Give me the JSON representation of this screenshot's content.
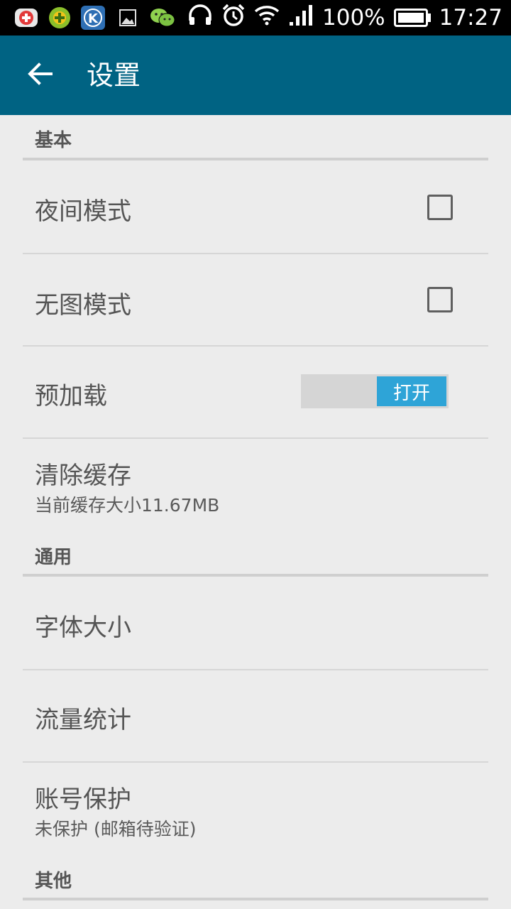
{
  "status_bar": {
    "notification_icons": [
      "red-plus-app-icon",
      "green-game-app-icon",
      "k-app-icon",
      "image-icon",
      "wechat-icon"
    ],
    "system_icons": [
      "headphones-icon",
      "alarm-icon",
      "wifi-icon",
      "signal-icon"
    ],
    "battery": "100%",
    "time": "17:27"
  },
  "app_bar": {
    "back_icon": "arrow-left-icon",
    "title": "设置"
  },
  "sections": {
    "basic": {
      "header": "基本",
      "night_mode": {
        "label": "夜间模式",
        "checked": false
      },
      "no_image_mode": {
        "label": "无图模式",
        "checked": false
      },
      "preload": {
        "label": "预加载",
        "toggle_text": "打开",
        "state": "on"
      },
      "clear_cache": {
        "label": "清除缓存",
        "subtitle": "当前缓存大小11.67MB"
      }
    },
    "general": {
      "header": "通用",
      "font_size": {
        "label": "字体大小"
      },
      "traffic_stats": {
        "label": "流量统计"
      },
      "account_protection": {
        "label": "账号保护",
        "subtitle": "未保护 (邮箱待验证)"
      }
    },
    "other": {
      "header": "其他"
    }
  },
  "colors": {
    "app_bar": "#006383",
    "toggle_on": "#2ea4d7",
    "background": "#ececec",
    "status_bar": "#000000"
  }
}
